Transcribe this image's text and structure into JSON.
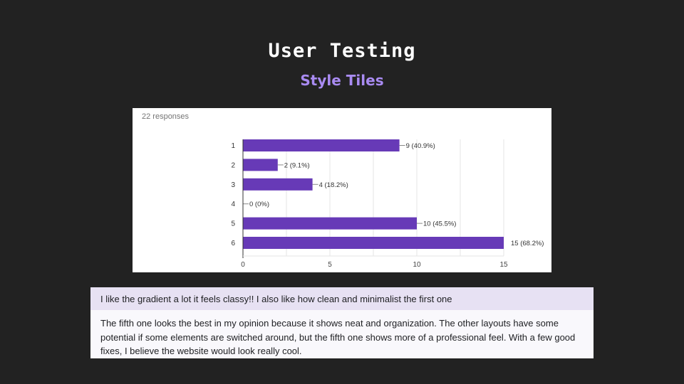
{
  "slide": {
    "title": "User Testing",
    "subtitle": "Style Tiles"
  },
  "chart_card": {
    "responses_label": "22 responses"
  },
  "chart_data": {
    "type": "bar",
    "orientation": "horizontal",
    "categories": [
      "1",
      "2",
      "3",
      "4",
      "5",
      "6"
    ],
    "values": [
      9,
      2,
      4,
      0,
      10,
      15
    ],
    "value_labels": [
      "9 (40.9%)",
      "2 (9.1%)",
      "4 (18.2%)",
      "0 (0%)",
      "10 (45.5%)",
      "15 (68.2%)"
    ],
    "xlim": [
      0,
      15
    ],
    "x_ticks": [
      0,
      5,
      10,
      15
    ],
    "bar_color": "#673ab7",
    "grid": true
  },
  "comments": [
    "I like the gradient a lot it feels classy!! I also like how clean and minimalist the first one",
    "The fifth one looks the best in my opinion because it shows neat and organization. The other layouts have some potential if some elements are switched around, but the fifth one shows more of a professional feel. With a few good fixes, I believe the website would look really cool."
  ]
}
